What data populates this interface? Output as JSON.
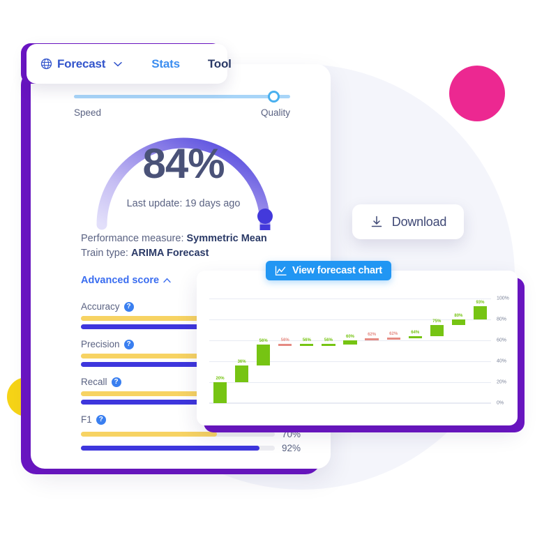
{
  "nav": {
    "brand_icon": "globe-icon",
    "brand_label": "Forecast",
    "chevron_icon": "chevron-down-icon",
    "stats_label": "Stats",
    "tool_label": "Tool"
  },
  "slider": {
    "left_label": "Speed",
    "right_label": "Quality",
    "value_pct": 95,
    "track_color": "#a8d5f8",
    "knob_color": "#49b0ef"
  },
  "gauge": {
    "value_text": "84%",
    "value_pct": 84,
    "subtitle": "Last update: 19 days ago",
    "gradient_start": "#ddd9f7",
    "gradient_end": "#3e36dd"
  },
  "meta": {
    "performance_label": "Performance measure:",
    "performance_value": "Symmetric Mean",
    "train_label": "Train type:",
    "train_value": "ARIMA Forecast"
  },
  "advanced": {
    "label": "Advanced score",
    "chevron_icon": "chevron-up-icon"
  },
  "metrics": [
    {
      "name": "Accuracy",
      "help_icon": "help-icon",
      "yellow_pct": 70,
      "blue_pct": 92,
      "yellow_label": "",
      "blue_label": ""
    },
    {
      "name": "Precision",
      "help_icon": "help-icon",
      "yellow_pct": 70,
      "blue_pct": 92,
      "yellow_label": "",
      "blue_label": ""
    },
    {
      "name": "Recall",
      "help_icon": "help-icon",
      "yellow_pct": 78,
      "blue_pct": 92,
      "yellow_label": "",
      "blue_label": ""
    },
    {
      "name": "F1",
      "help_icon": "help-icon",
      "yellow_pct": 70,
      "blue_pct": 92,
      "yellow_label": "70%",
      "blue_label": "92%"
    }
  ],
  "download": {
    "icon": "download-icon",
    "label": "Download"
  },
  "chart_pill": {
    "icon": "line-chart-icon",
    "label": "View forecast chart",
    "color": "#2196f3"
  },
  "chart_data": {
    "type": "bar",
    "subtype": "waterfall",
    "title": "",
    "xlabel": "",
    "ylabel": "",
    "ylim": [
      0,
      100
    ],
    "yticks": [
      "0%",
      "20%",
      "40%",
      "60%",
      "80%",
      "100%"
    ],
    "ytick_values": [
      0,
      20,
      40,
      60,
      80,
      100
    ],
    "grid": true,
    "legend": "none",
    "positive_color": "#76c413",
    "negative_color": "#e58a82",
    "labels": [
      "20%",
      "36%",
      "56%",
      "56%",
      "56%",
      "56%",
      "60%",
      "62%",
      "62%",
      "64%",
      "75%",
      "80%",
      "93%"
    ],
    "values": [
      20,
      36,
      56,
      56,
      56,
      56,
      60,
      62,
      62,
      64,
      75,
      80,
      93
    ],
    "starts": [
      0,
      20,
      36,
      56,
      56,
      56,
      56,
      60,
      62,
      62,
      64,
      75,
      80
    ],
    "ends": [
      20,
      36,
      56,
      56,
      56,
      56,
      60,
      62,
      62,
      64,
      75,
      80,
      93
    ],
    "kinds": [
      "pos",
      "pos",
      "pos",
      "neg",
      "pos",
      "pos",
      "pos",
      "neg",
      "neg",
      "pos",
      "pos",
      "pos",
      "pos"
    ]
  },
  "decor": {
    "pink_dot": "#ec2891",
    "yellow_dot": "#f6d417",
    "card_shadow_purple": "#6b15c4",
    "background_circle": "#f4f5fb"
  }
}
